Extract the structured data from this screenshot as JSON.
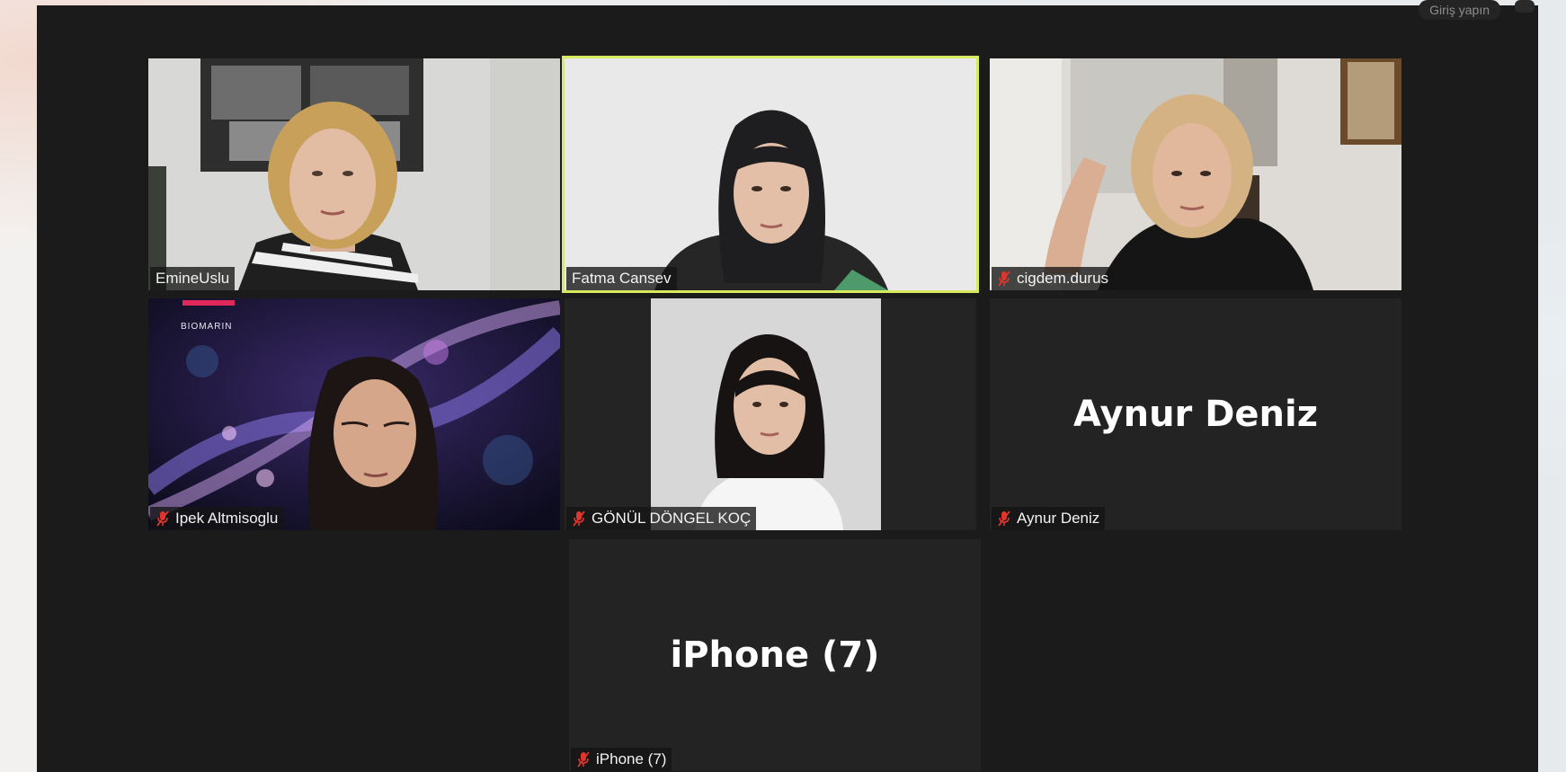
{
  "window": {
    "signin_hint": "Giriş yapın"
  },
  "participants": [
    {
      "id": "emine",
      "name": "EmineUslu",
      "muted": false,
      "has_video": true,
      "active_speaker": false
    },
    {
      "id": "fatma",
      "name": "Fatma Cansev",
      "muted": false,
      "has_video": true,
      "active_speaker": true
    },
    {
      "id": "cigdem",
      "name": "cigdem.durus",
      "muted": true,
      "has_video": true,
      "active_speaker": false
    },
    {
      "id": "ipek",
      "name": "Ipek Altmisoglu",
      "muted": true,
      "has_video": true,
      "active_speaker": false,
      "background_brand": "BIOMARIN"
    },
    {
      "id": "gonul",
      "name": "GÖNÜL DÖNGEL KOÇ",
      "muted": true,
      "has_video": true,
      "active_speaker": false
    },
    {
      "id": "aynur",
      "name": "Aynur Deniz",
      "display_name": "Aynur Deniz",
      "muted": true,
      "has_video": false,
      "active_speaker": false
    },
    {
      "id": "iphone",
      "name": "iPhone (7)",
      "display_name": "iPhone (7)",
      "muted": true,
      "has_video": false,
      "active_speaker": false
    }
  ],
  "icons": {
    "mute": "microphone-muted-icon"
  },
  "colors": {
    "window_bg": "#1b1b1b",
    "tile_bg": "#232323",
    "active_speaker_outline": "#d8ea5e",
    "mute_red": "#e0352f"
  }
}
